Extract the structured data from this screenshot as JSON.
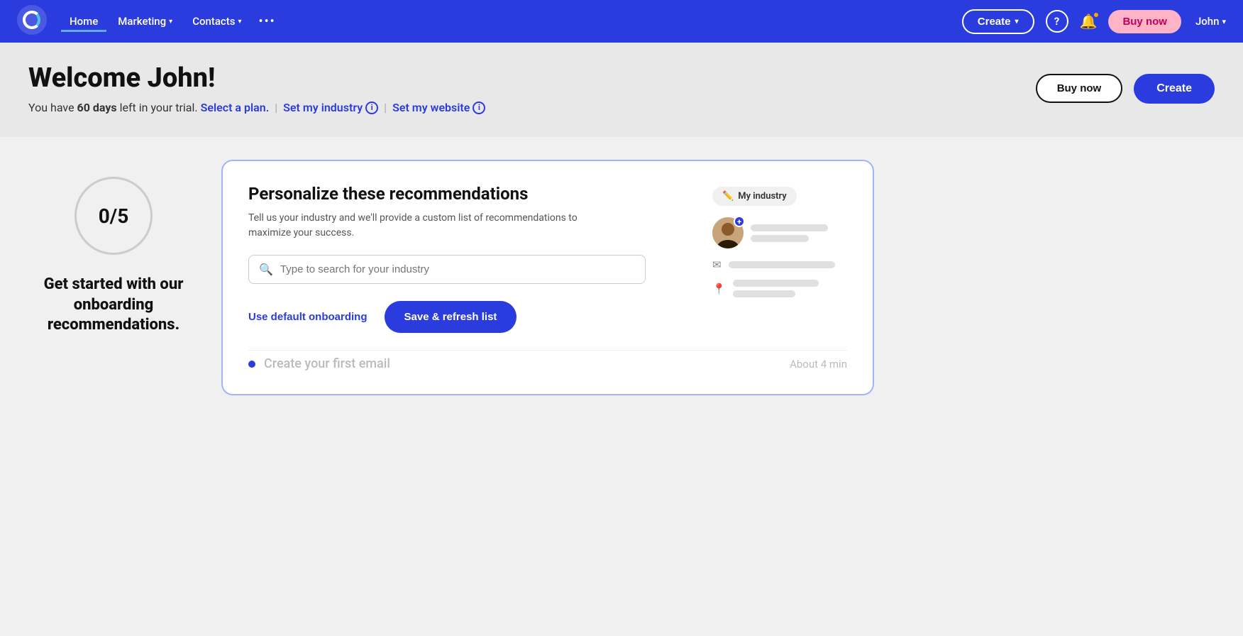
{
  "nav": {
    "logo_alt": "Constant Contact logo",
    "links": [
      {
        "label": "Home",
        "active": true
      },
      {
        "label": "Marketing",
        "has_dropdown": true
      },
      {
        "label": "Contacts",
        "has_dropdown": true
      }
    ],
    "more_label": "•••",
    "create_label": "Create",
    "help_label": "?",
    "buy_now_label": "Buy now",
    "user_label": "John"
  },
  "header": {
    "title": "Welcome John!",
    "subtitle_intro": "You have ",
    "days_bold": "60 days",
    "subtitle_mid": " left in your trial.",
    "select_plan_label": "Select a plan.",
    "set_industry_label": "Set my industry",
    "set_website_label": "Set my website",
    "buy_now_label": "Buy now",
    "create_label": "Create"
  },
  "onboarding": {
    "progress_label": "0/5",
    "get_started_text": "Get started with our onboarding recommendations.",
    "card": {
      "title": "Personalize these recommendations",
      "desc": "Tell us your industry and we'll provide a custom list of recommendations to maximize your success.",
      "search_placeholder": "Type to search for your industry",
      "use_default_label": "Use default onboarding",
      "save_label": "Save & refresh list",
      "my_industry_label": "My industry"
    },
    "bottom_teaser": {
      "text": "Create your first email",
      "time": "About 4 min"
    }
  }
}
